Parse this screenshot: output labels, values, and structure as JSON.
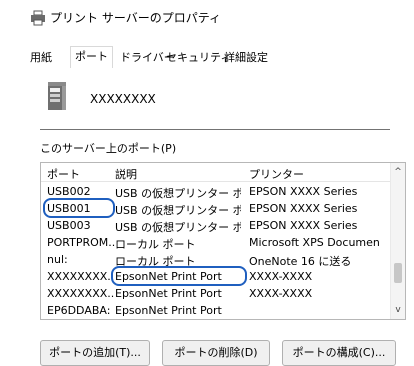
{
  "window": {
    "title": "プリント サーバーのプロパティ"
  },
  "tabs": [
    {
      "label": "用紙"
    },
    {
      "label": "ポート"
    },
    {
      "label": "ドライバー"
    },
    {
      "label": "セキュリティ"
    },
    {
      "label": "詳細設定"
    }
  ],
  "server": {
    "name": "XXXXXXXX"
  },
  "ports_label": "このサーバー上のポート(P)",
  "columns": {
    "port": "ポート",
    "description": "説明",
    "printer": "プリンター"
  },
  "rows": [
    {
      "port": "USB002",
      "description": "USB の仮想プリンター ポート",
      "printer": "EPSON XXXX Series"
    },
    {
      "port": "USB001",
      "description": "USB の仮想プリンター ポート",
      "printer": "EPSON XXXX Series"
    },
    {
      "port": "USB003",
      "description": "USB の仮想プリンター ポート",
      "printer": "EPSON XXXX Series"
    },
    {
      "port": "PORTPROM...",
      "description": "ローカル ポート",
      "printer": "Microsoft XPS Documen"
    },
    {
      "port": "nul:",
      "description": "ローカル ポート",
      "printer": "OneNote 16 に送る"
    },
    {
      "port": "XXXXXXXX...",
      "description": "EpsonNet Print Port",
      "printer": "XXXX-XXXX"
    },
    {
      "port": "XXXXXXXX...",
      "description": "EpsonNet Print Port",
      "printer": "XXXX-XXXX"
    },
    {
      "port": "EP6DDABA:",
      "description": "EpsonNet Print Port",
      "printer": ""
    }
  ],
  "buttons": {
    "add": "ポートの追加(T)...",
    "delete": "ポートの削除(D)",
    "configure": "ポートの構成(C)..."
  },
  "colors": {
    "highlight": "#1f5fbf"
  }
}
